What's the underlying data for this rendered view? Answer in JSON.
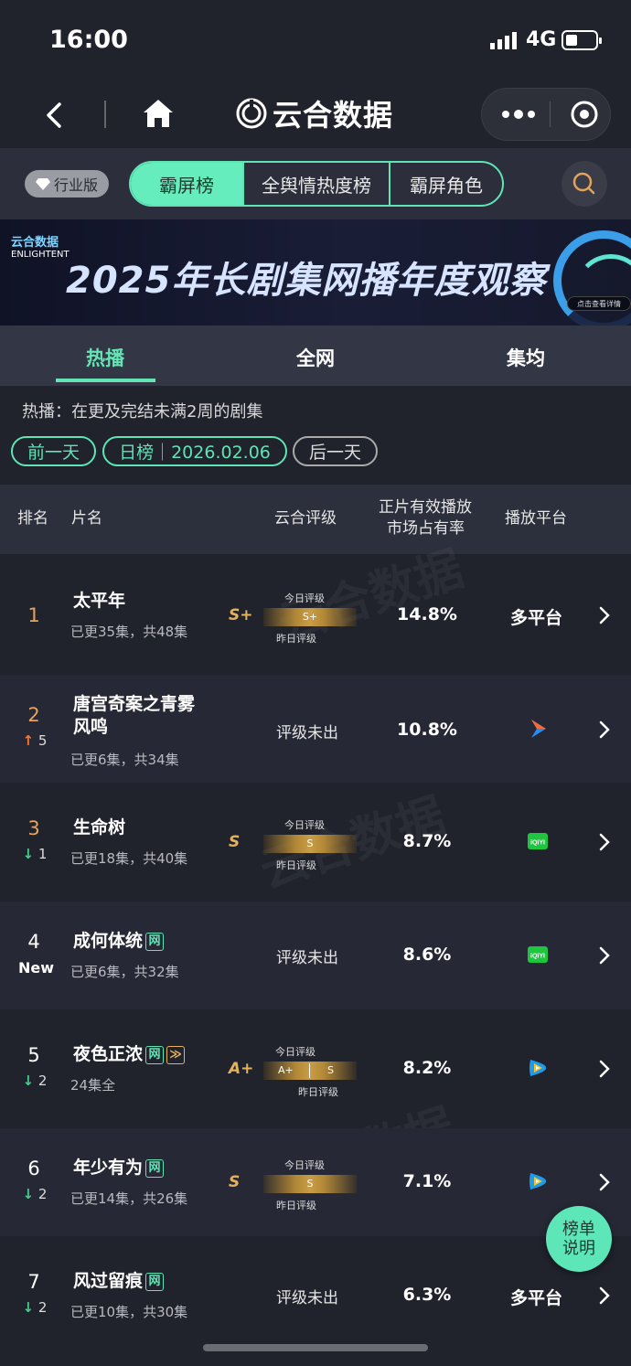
{
  "status": {
    "time": "16:00",
    "network": "4G"
  },
  "nav": {
    "title": "云合数据"
  },
  "filter": {
    "industry_label": "行业版",
    "segments": [
      "霸屏榜",
      "全舆情热度榜",
      "霸屏角色"
    ]
  },
  "banner": {
    "logo_cn": "云合数据",
    "logo_en": "ENLIGHTENT",
    "title": "2025年长剧集网播年度观察",
    "button": "点击查看详情"
  },
  "tabs": [
    "热播",
    "全网",
    "集均"
  ],
  "description": "热播：在更及完结未满2周的剧集",
  "date_nav": {
    "prev": "前一天",
    "current": "日榜｜2026.02.06",
    "next": "后一天"
  },
  "columns": {
    "rank": "排名",
    "title": "片名",
    "rating": "云合评级",
    "share_l1": "正片有效播放",
    "share_l2": "市场占有率",
    "platform": "播放平台"
  },
  "rating_labels": {
    "today": "今日评级",
    "yesterday": "昨日评级",
    "none": "评级未出"
  },
  "rows": [
    {
      "rank": "1",
      "change": "",
      "title": "太平年",
      "title2": "",
      "badge": "",
      "sub": "已更35集，共48集",
      "grade": "S+",
      "today": "S+",
      "yesterday": "",
      "share": "14.8%",
      "platform": "多平台",
      "platform_icon": ""
    },
    {
      "rank": "2",
      "change": "↑5",
      "title": "唐宫奇案之青雾",
      "title2": "风鸣",
      "badge": "",
      "sub": "已更6集，共34集",
      "grade": "",
      "today": "",
      "yesterday": "",
      "share": "10.8%",
      "platform": "",
      "platform_icon": "youku-icon"
    },
    {
      "rank": "3",
      "change": "↓1",
      "title": "生命树",
      "title2": "",
      "badge": "",
      "sub": "已更18集，共40集",
      "grade": "S",
      "today": "S",
      "yesterday": "",
      "share": "8.7%",
      "platform": "",
      "platform_icon": "iqiyi-icon"
    },
    {
      "rank": "4",
      "change": "New",
      "title": "成何体统",
      "title2": "",
      "badge": "网",
      "sub": "已更6集，共32集",
      "grade": "",
      "today": "",
      "yesterday": "",
      "share": "8.6%",
      "platform": "",
      "platform_icon": "iqiyi-icon"
    },
    {
      "rank": "5",
      "change": "↓2",
      "title": "夜色正浓",
      "title2": "",
      "badge": "网",
      "sub": "24集全",
      "grade": "A+",
      "today": "A+",
      "yesterday": "S",
      "share": "8.2%",
      "platform": "",
      "platform_icon": "tencent-video-icon"
    },
    {
      "rank": "6",
      "change": "↓2",
      "title": "年少有为",
      "title2": "",
      "badge": "网",
      "sub": "已更14集，共26集",
      "grade": "S",
      "today": "S",
      "yesterday": "",
      "share": "7.1%",
      "platform": "",
      "platform_icon": "tencent-video-icon"
    },
    {
      "rank": "7",
      "change": "↓2",
      "title": "风过留痕",
      "title2": "",
      "badge": "网",
      "sub": "已更10集，共30集",
      "grade": "",
      "today": "",
      "yesterday": "",
      "share": "6.3%",
      "platform": "多平台",
      "platform_icon": ""
    }
  ],
  "float_button": {
    "line1": "榜单",
    "line2": "说明"
  },
  "colors": {
    "accent": "#63e6b4",
    "gold": "#e3b25c",
    "up": "#f07a3c",
    "down": "#4cc98f"
  }
}
